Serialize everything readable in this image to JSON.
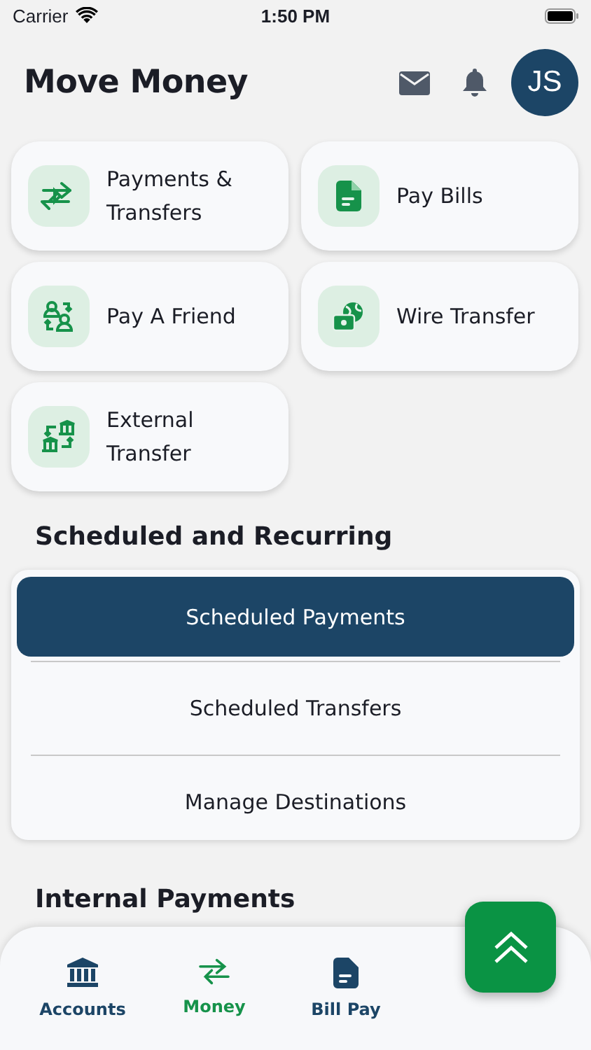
{
  "status_bar": {
    "carrier": "Carrier",
    "time": "1:50 PM"
  },
  "header": {
    "title": "Move Money",
    "avatar": "JS"
  },
  "actions": [
    {
      "label": "Payments & Transfers"
    },
    {
      "label": "Pay Bills"
    },
    {
      "label": "Pay A Friend"
    },
    {
      "label": "Wire Transfer"
    },
    {
      "label": "External Transfer"
    }
  ],
  "scheduled": {
    "title": "Scheduled and Recurring",
    "items": [
      {
        "label": "Scheduled Payments",
        "selected": true
      },
      {
        "label": "Scheduled Transfers",
        "selected": false
      },
      {
        "label": "Manage Destinations",
        "selected": false
      }
    ]
  },
  "next_section": {
    "title": "Internal Payments"
  },
  "tab_bar": [
    {
      "label": "Accounts",
      "selected": false
    },
    {
      "label": "Money",
      "selected": true
    },
    {
      "label": "Bill Pay",
      "selected": false
    }
  ]
}
